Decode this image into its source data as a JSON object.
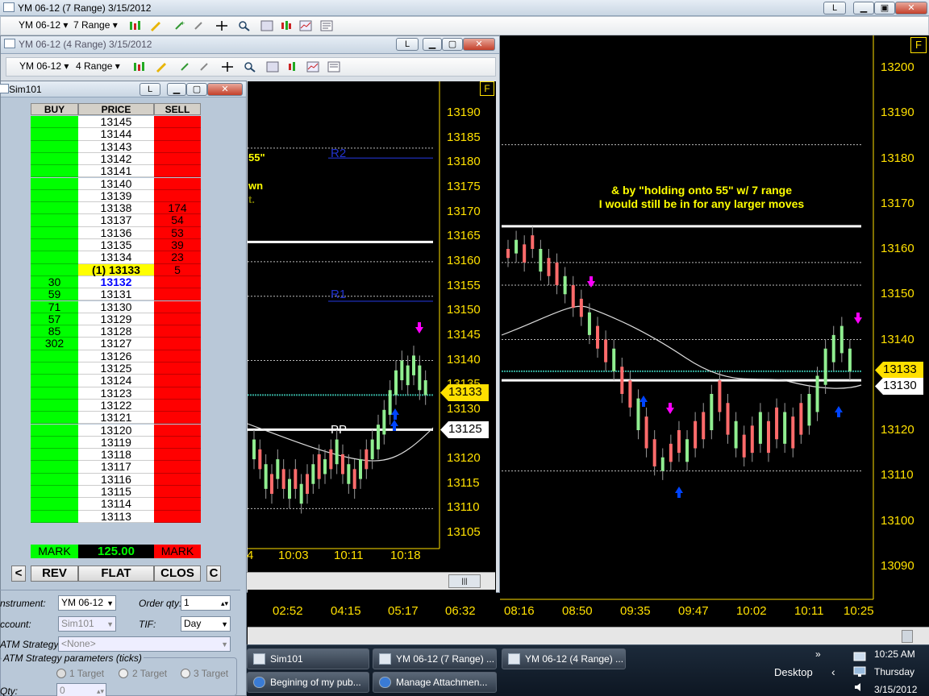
{
  "main_window": {
    "title": "YM 06-12 (7 Range)  3/15/2012",
    "instrument": "YM 06-12",
    "period": "7 Range",
    "btn_l": "L",
    "badge": "F",
    "annotation_line1": "& by \"holding onto 55\" w/ 7 range",
    "annotation_line2": "I would still be in for any larger moves",
    "y_labels": [
      "13200",
      "13190",
      "13180",
      "13170",
      "13160",
      "13150",
      "13140",
      "13130",
      "13120",
      "13110",
      "13100",
      "13090"
    ],
    "x_labels": [
      "08:16",
      "08:50",
      "09:35",
      "09:47",
      "10:02",
      "10:11",
      "10:25"
    ],
    "x_labels_left": [
      "02:52",
      "04:15",
      "05:17",
      "06:32"
    ],
    "price_last": "13133",
    "price_level": "13130"
  },
  "second_window": {
    "title": "YM 06-12 (4 Range)  3/15/2012",
    "instrument": "YM 06-12",
    "period": "4 Range",
    "btn_l": "L",
    "badge": "F",
    "partial_text1": "55\"",
    "partial_text2": "wn",
    "partial_text3": "t.",
    "r2": "R2",
    "r1": "R1",
    "pp": "PP",
    "y_labels": [
      "13190",
      "13185",
      "13180",
      "13175",
      "13170",
      "13165",
      "13160",
      "13155",
      "13150",
      "13145",
      "13140",
      "13135",
      "13130",
      "13125",
      "13120",
      "13115",
      "13110",
      "13105"
    ],
    "x_labels": [
      "4",
      "10:03",
      "10:11",
      "10:18"
    ],
    "price_last": "13133",
    "price_pp": "13125"
  },
  "dom_window": {
    "title": "Sim101",
    "btn_l": "L",
    "headers": {
      "buy": "BUY",
      "price": "PRICE",
      "sell": "SELL"
    },
    "rows": [
      {
        "buy": "",
        "price": "13145",
        "sell": ""
      },
      {
        "buy": "",
        "price": "13144",
        "sell": ""
      },
      {
        "buy": "",
        "price": "13143",
        "sell": ""
      },
      {
        "buy": "",
        "price": "13142",
        "sell": ""
      },
      {
        "buy": "",
        "price": "13141",
        "sell": ""
      },
      {
        "buy": "",
        "price": "13140",
        "sell": ""
      },
      {
        "buy": "",
        "price": "13139",
        "sell": ""
      },
      {
        "buy": "",
        "price": "13138",
        "sell": "174"
      },
      {
        "buy": "",
        "price": "13137",
        "sell": "54"
      },
      {
        "buy": "",
        "price": "13136",
        "sell": "53"
      },
      {
        "buy": "",
        "price": "13135",
        "sell": "39"
      },
      {
        "buy": "",
        "price": "13134",
        "sell": "23"
      },
      {
        "buy": "",
        "price": "(1) 13133",
        "sell": "5"
      },
      {
        "buy": "30",
        "price": "13132",
        "sell": ""
      },
      {
        "buy": "59",
        "price": "13131",
        "sell": ""
      },
      {
        "buy": "71",
        "price": "13130",
        "sell": ""
      },
      {
        "buy": "57",
        "price": "13129",
        "sell": ""
      },
      {
        "buy": "85",
        "price": "13128",
        "sell": ""
      },
      {
        "buy": "302",
        "price": "13127",
        "sell": ""
      },
      {
        "buy": "",
        "price": "13126",
        "sell": ""
      },
      {
        "buy": "",
        "price": "13125",
        "sell": ""
      },
      {
        "buy": "",
        "price": "13124",
        "sell": ""
      },
      {
        "buy": "",
        "price": "13123",
        "sell": ""
      },
      {
        "buy": "",
        "price": "13122",
        "sell": ""
      },
      {
        "buy": "",
        "price": "13121",
        "sell": ""
      },
      {
        "buy": "",
        "price": "13120",
        "sell": ""
      },
      {
        "buy": "",
        "price": "13119",
        "sell": ""
      },
      {
        "buy": "",
        "price": "13118",
        "sell": ""
      },
      {
        "buy": "",
        "price": "13117",
        "sell": ""
      },
      {
        "buy": "",
        "price": "13116",
        "sell": ""
      },
      {
        "buy": "",
        "price": "13115",
        "sell": ""
      },
      {
        "buy": "",
        "price": "13114",
        "sell": ""
      },
      {
        "buy": "",
        "price": "13113",
        "sell": ""
      }
    ],
    "mark_buy": "MARK",
    "mark_price": "125.00",
    "mark_sell": "MARK",
    "btn_prev": "<",
    "btn_rev": "REV",
    "btn_flat": "FLAT",
    "btn_close": "CLOS",
    "btn_c": "C",
    "instrument_label": "nstrument:",
    "instrument_value": "YM 06-12",
    "order_qty_label": "Order qty:",
    "order_qty_value": "1",
    "account_label": "ccount:",
    "account_value": "Sim101",
    "tif_label": "TIF:",
    "tif_value": "Day",
    "atm_label": "ATM Strategy:",
    "atm_value": "<None>",
    "atm_params": "ATM Strategy parameters (ticks)",
    "target1": "1 Target",
    "target2": "2 Target",
    "target3": "3 Target",
    "qty_label": "Qty:",
    "qty_value": "0"
  },
  "taskbar": {
    "items": [
      {
        "label": "Sim101"
      },
      {
        "label": "YM 06-12 (7 Range) ..."
      },
      {
        "label": "YM 06-12 (4 Range) ..."
      },
      {
        "label": "Begining of my pub..."
      },
      {
        "label": "Manage Attachmen..."
      }
    ],
    "desktop": "Desktop",
    "time": "10:25 AM",
    "day": "Thursday",
    "date": "3/15/2012",
    "chevron": "»"
  },
  "colors": {
    "buy_green": "#00ff00",
    "sell_red": "#ff0000",
    "axis_yellow": "#ffe000",
    "annotation_yellow": "#ffff00",
    "down_candle": "#ff6b6b",
    "up_candle": "#90ee90",
    "magenta_arrow": "#ff00ff",
    "blue_arrow": "#0044ff"
  }
}
